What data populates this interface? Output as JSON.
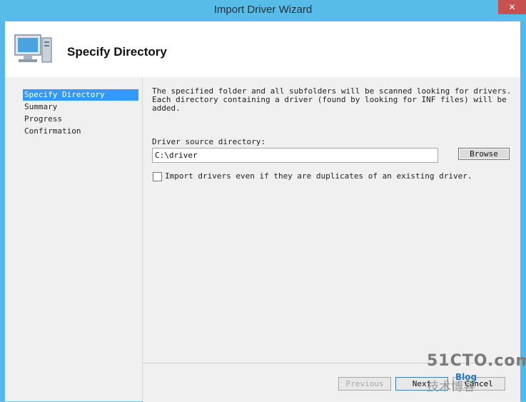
{
  "window": {
    "title": "Import Driver Wizard",
    "close_glyph": "✕"
  },
  "header": {
    "title": "Specify Directory",
    "icon": "computer-icon"
  },
  "nav": {
    "items": [
      {
        "label": "Specify Directory",
        "selected": true
      },
      {
        "label": "Summary",
        "selected": false
      },
      {
        "label": "Progress",
        "selected": false
      },
      {
        "label": "Confirmation",
        "selected": false
      }
    ]
  },
  "content": {
    "description": "The specified folder and all subfolders will be scanned looking for drivers.  Each directory containing a driver (found by looking for INF files) will be added.",
    "directory_label": "Driver source directory:",
    "directory_value": "C:\\driver",
    "browse_label": "Browse",
    "duplicates_label": "Import drivers even if they are duplicates of an existing driver.",
    "duplicates_checked": false
  },
  "footer": {
    "previous_label": "Previous",
    "next_label": "Next",
    "cancel_label": "Cancel"
  },
  "watermark": {
    "site": "51CTO.com",
    "sub": "技术博客",
    "blog": "Blog"
  }
}
